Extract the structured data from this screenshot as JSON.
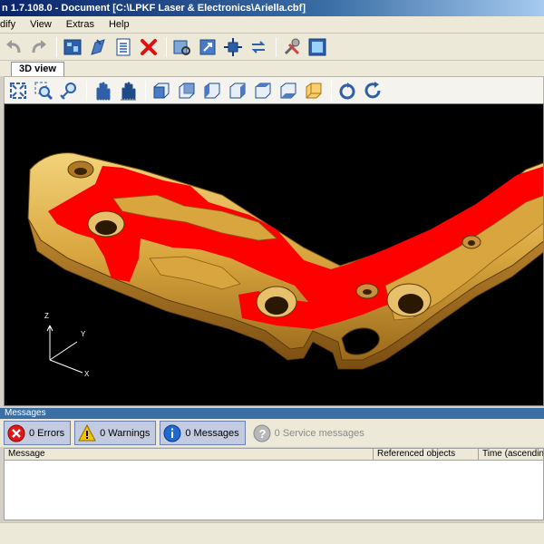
{
  "window": {
    "title": "n 1.7.108.0 - Document [C:\\LPKF Laser & Electronics\\Ariella.cbf]"
  },
  "menu": [
    "dify",
    "View",
    "Extras",
    "Help"
  ],
  "tabs": [
    {
      "label": "3D view"
    }
  ],
  "axes": {
    "z": "Z",
    "y": "Y",
    "x": "X"
  },
  "colors": {
    "gold": "#d4a640",
    "trace": "#ff0000",
    "background": "#000000",
    "titlebar": "#0a246a"
  },
  "messages": {
    "header": "Messages",
    "buttons": {
      "errors": "0 Errors",
      "warnings": "0 Warnings",
      "messages": "0 Messages",
      "service": "0 Service messages"
    },
    "columns": [
      "Message",
      "Referenced objects",
      "Time (ascending)"
    ]
  },
  "icons": {
    "toolbar": [
      "undo-icon",
      "redo-icon",
      "pcb-icon",
      "export-icon",
      "list-icon",
      "delete-icon",
      "view-zoom-icon",
      "view-transform-icon",
      "move-part-icon",
      "connect-icon",
      "tools-icon",
      "window-icon"
    ],
    "view_toolbar": [
      "zoom-fit-icon",
      "zoom-icon",
      "zoom-move-icon",
      "pan-hand-icon",
      "pan-hand-2-icon",
      "view-front-icon",
      "view-back-icon",
      "view-left-icon",
      "view-right-icon",
      "view-top-icon",
      "view-bottom-icon",
      "view-iso-icon",
      "rotate-icon",
      "refresh-icon"
    ]
  }
}
